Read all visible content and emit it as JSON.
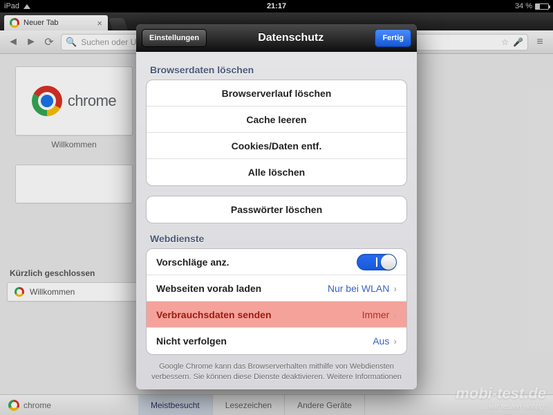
{
  "statusbar": {
    "device": "iPad",
    "time": "21:17",
    "battery": "34 %"
  },
  "browser": {
    "tab_title": "Neuer Tab",
    "omnibox_placeholder": "Suchen oder URL eingeben"
  },
  "page": {
    "logo_text": "chrome",
    "welcome": "Willkommen",
    "recent_heading": "Kürzlich geschlossen",
    "recent_item": "Willkommen"
  },
  "bottombar": {
    "brand": "chrome",
    "tabs": [
      "Meistbesucht",
      "Lesezeichen",
      "Andere Geräte"
    ]
  },
  "modal": {
    "back_label": "Einstellungen",
    "title": "Datenschutz",
    "done_label": "Fertig",
    "sections": {
      "clear": {
        "title": "Browserdaten löschen",
        "items": [
          "Browserverlauf löschen",
          "Cache leeren",
          "Cookies/Daten entf.",
          "Alle löschen"
        ],
        "passwords": "Passwörter löschen"
      },
      "web": {
        "title": "Webdienste",
        "rows": [
          {
            "label": "Vorschläge anz.",
            "value": "on"
          },
          {
            "label": "Webseiten vorab laden",
            "value": "Nur bei WLAN"
          },
          {
            "label": "Verbrauchsdaten senden",
            "value": "Immer"
          },
          {
            "label": "Nicht verfolgen",
            "value": "Aus"
          }
        ]
      }
    },
    "footnote": "Google Chrome kann das Browserverhalten mithilfe von Webdiensten verbessern. Sie können diese Dienste deaktivieren. Weitere Informationen"
  },
  "watermark": {
    "line1": "mobi-test.de",
    "line2": "... wir testen richtig!"
  }
}
